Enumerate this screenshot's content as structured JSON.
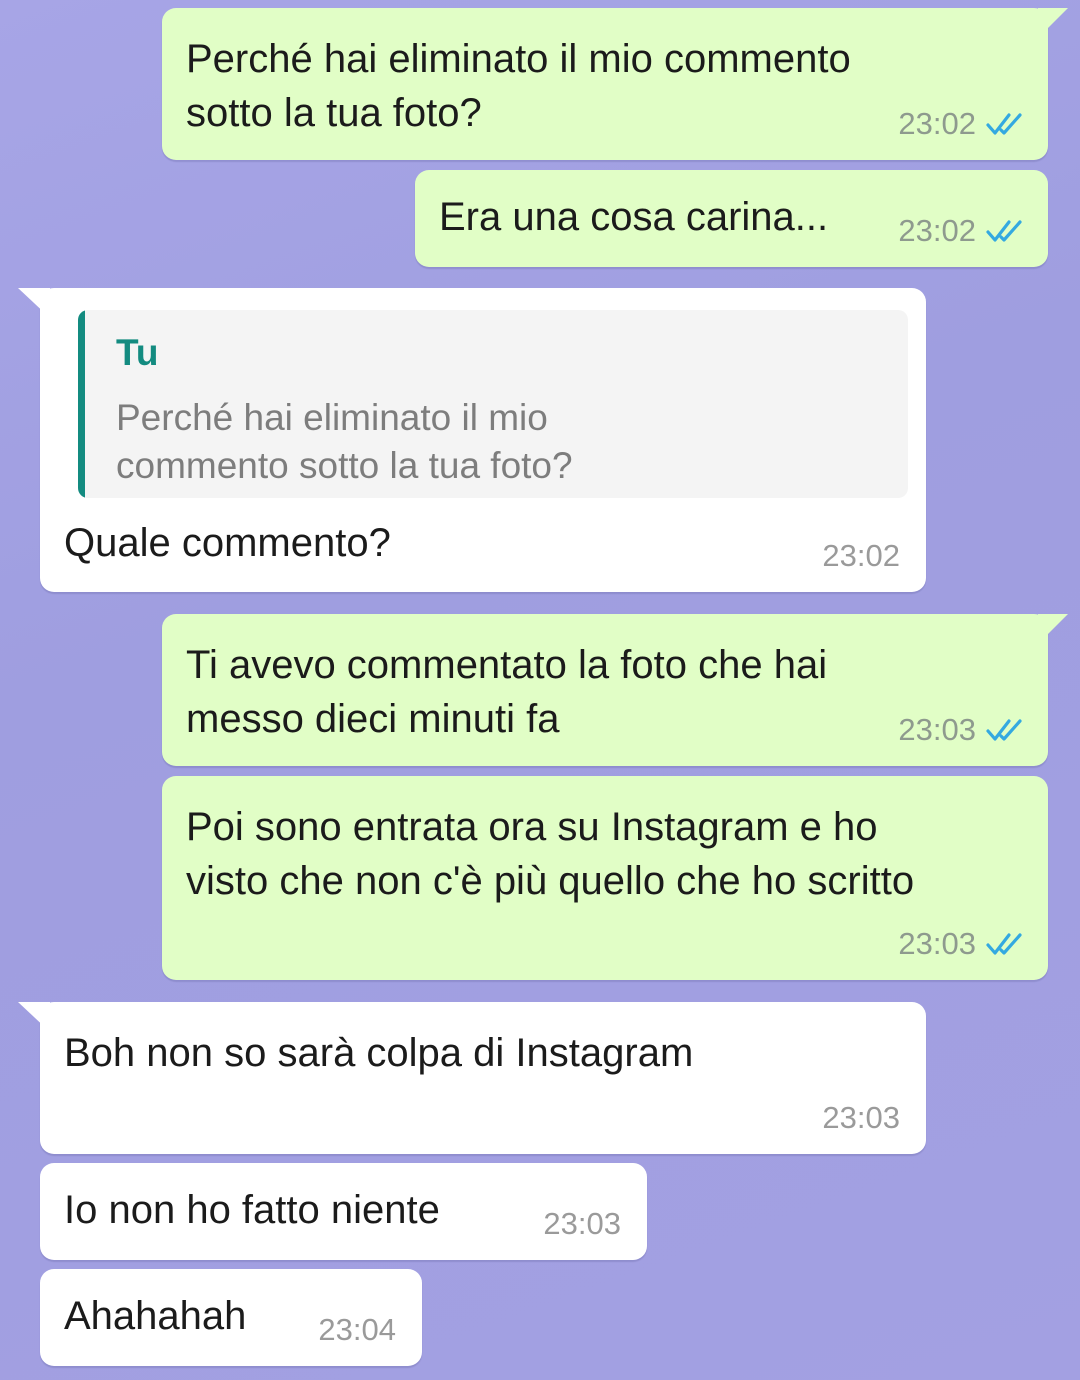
{
  "colors": {
    "outgoing": "#e1fec6",
    "incoming": "#ffffff",
    "read_ticks": "#34a9e0",
    "quote_accent": "#138b80"
  },
  "messages": [
    {
      "text": "Perché hai eliminato il mio commento\nsotto la tua foto?",
      "time": "23:02",
      "status_icon": "double-check-read-icon"
    },
    {
      "text": "Era una cosa carina...",
      "time": "23:02",
      "status_icon": "double-check-read-icon"
    },
    {
      "reply": {
        "author": "Tu",
        "text": "Perché hai eliminato il mio\ncommento sotto la tua foto?"
      },
      "text": "Quale commento?",
      "time": "23:02"
    },
    {
      "text": "Ti avevo commentato la foto che hai\nmesso dieci minuti fa",
      "time": "23:03",
      "status_icon": "double-check-read-icon"
    },
    {
      "text": "Poi sono entrata ora su Instagram e ho\nvisto che non c'è più quello che ho scritto",
      "time": "23:03",
      "status_icon": "double-check-read-icon"
    },
    {
      "text": "Boh non so sarà colpa di Instagram",
      "time": "23:03"
    },
    {
      "text": "Io non ho fatto niente",
      "time": "23:03"
    },
    {
      "text": "Ahahahah",
      "time": "23:04"
    }
  ]
}
